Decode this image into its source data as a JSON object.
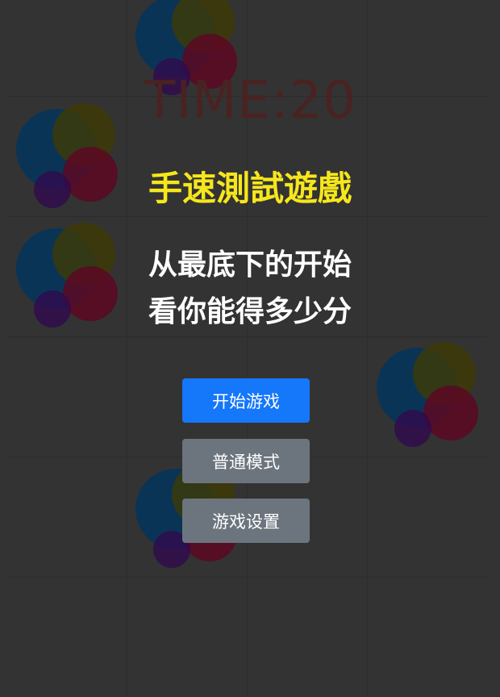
{
  "game": {
    "time_text": "TIME:20",
    "title": "手速測試遊戲",
    "instructions": [
      "从最底下的开始",
      "看你能得多少分"
    ]
  },
  "buttons": {
    "start": "开始游戏",
    "mode": "普通模式",
    "settings": "游戏设置"
  },
  "colors": {
    "background": "#333333",
    "title": "#f6e71c",
    "time": "#4a2222",
    "primary_button": "#1577fa",
    "secondary_button": "#6c757e"
  }
}
